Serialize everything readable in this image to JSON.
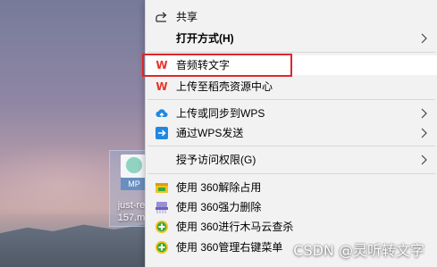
{
  "desktop": {
    "file": {
      "badge": "MP",
      "label_line1": "just-re",
      "label_line2": "157.m"
    }
  },
  "menu": {
    "items": [
      {
        "label": "共享",
        "icon": "share-icon",
        "submenu": false
      },
      {
        "label": "打开方式(H)",
        "icon": "none",
        "submenu": true,
        "bold": true
      },
      {
        "label": "音频转文字",
        "icon": "wps-icon",
        "submenu": false,
        "highlighted": true
      },
      {
        "label": "上传至稻壳资源中心",
        "icon": "wps-icon",
        "submenu": false
      },
      {
        "label": "上传或同步到WPS",
        "icon": "cloud-upload-icon",
        "submenu": true
      },
      {
        "label": "通过WPS发送",
        "icon": "send-arrow-icon",
        "submenu": true
      },
      {
        "label": "授予访问权限(G)",
        "icon": "none",
        "submenu": true
      },
      {
        "label": "使用 360解除占用",
        "icon": "360-unlock-icon",
        "submenu": false
      },
      {
        "label": "使用 360强力删除",
        "icon": "360-shred-icon",
        "submenu": false
      },
      {
        "label": "使用 360进行木马云查杀",
        "icon": "360-shield-icon",
        "submenu": false
      },
      {
        "label": "使用 360管理右键菜单",
        "icon": "360-shield-icon",
        "submenu": false
      }
    ]
  },
  "watermark": "CSDN @灵听转文字",
  "colors": {
    "menu_bg": "#f2f2f2",
    "highlight_border": "#e0262b",
    "wps_red": "#e8332a",
    "cloud_blue": "#1e88e5",
    "shield_green": "#3aa83a",
    "shield_yellow": "#f2c31c"
  }
}
